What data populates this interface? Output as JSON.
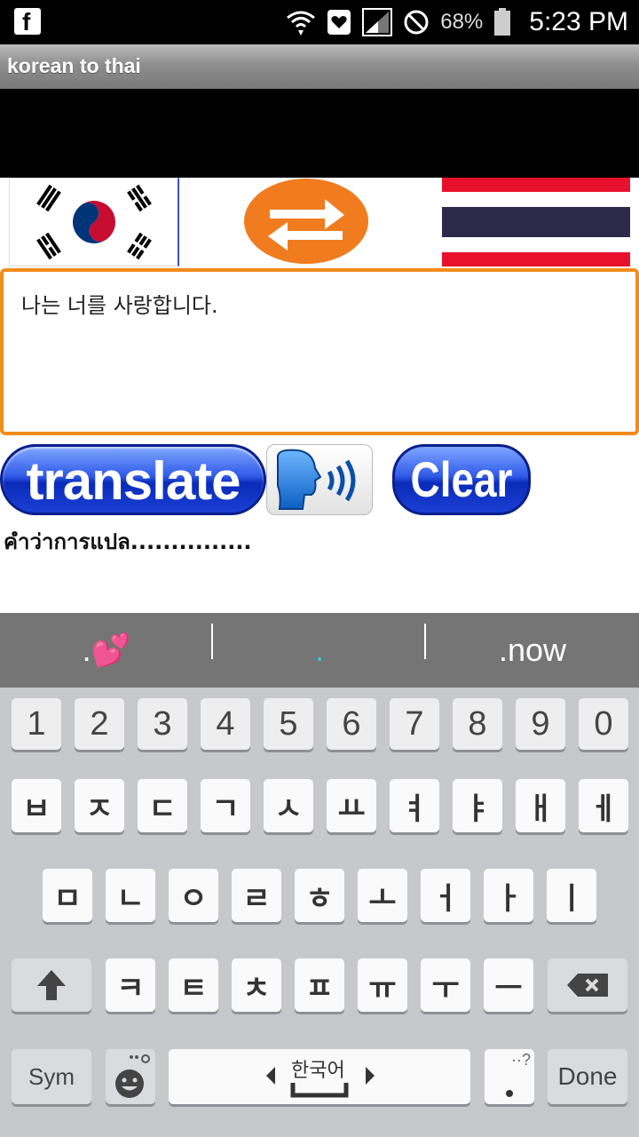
{
  "status_bar": {
    "battery_percent": "68%",
    "time": "5:23 PM",
    "icons": [
      "facebook-icon",
      "wifi-icon",
      "heart-icon",
      "signal-icon",
      "do-not-disturb-icon",
      "battery-icon"
    ]
  },
  "app": {
    "title": "korean to thai"
  },
  "flags": {
    "source": "korea-flag",
    "swap": "swap-icon",
    "target": "thailand-flag"
  },
  "input": {
    "value": "나는 너를 사랑합니다."
  },
  "buttons": {
    "translate": "translate",
    "clear": "Clear",
    "speak": "speaker-icon"
  },
  "result": {
    "text": "คำว่าการแปล..............."
  },
  "suggestions": {
    "left": ".💕",
    "middle": ".",
    "right": ".now"
  },
  "keyboard": {
    "numbers": [
      "1",
      "2",
      "3",
      "4",
      "5",
      "6",
      "7",
      "8",
      "9",
      "0"
    ],
    "row1": [
      "ㅂ",
      "ㅈ",
      "ㄷ",
      "ㄱ",
      "ㅅ",
      "ㅛ",
      "ㅕ",
      "ㅑ",
      "ㅐ",
      "ㅔ"
    ],
    "row2": [
      "ㅁ",
      "ㄴ",
      "ㅇ",
      "ㄹ",
      "ㅎ",
      "ㅗ",
      "ㅓ",
      "ㅏ",
      "ㅣ"
    ],
    "row3": [
      "ㅋ",
      "ㅌ",
      "ㅊ",
      "ㅍ",
      "ㅠ",
      "ㅜ",
      "ㅡ"
    ],
    "sym": "Sym",
    "space_language": "한국어",
    "done": "Done",
    "punct_hint": "··?"
  }
}
